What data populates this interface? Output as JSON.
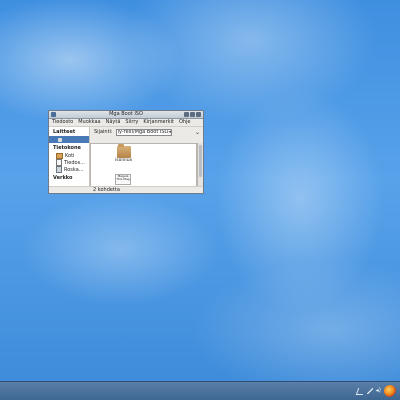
{
  "window": {
    "title": "Mga Boot ISO",
    "menu": [
      "Tiedosto",
      "Muokkaa",
      "Näytä",
      "Siirry",
      "Kirjanmerkit",
      "Ohje"
    ],
    "sidebar": {
      "sections": [
        {
          "heading": "Laitteet",
          "items": [
            {
              "label": "",
              "icon": "drive-icon",
              "selected": true
            }
          ]
        },
        {
          "heading": "Tietokone",
          "items": [
            {
              "label": "Koti",
              "icon": "home-folder-icon",
              "selected": false
            },
            {
              "label": "Tiedos...",
              "icon": "filesystem-icon",
              "selected": false
            },
            {
              "label": "Roska...",
              "icon": "trash-icon",
              "selected": false
            }
          ]
        },
        {
          "heading": "Verkko",
          "items": []
        }
      ]
    },
    "location": {
      "label": "Sijainti:",
      "value": "ly-rexi/Mga Boot ISO"
    },
    "files": [
      {
        "name": "isolinux",
        "type": "folder",
        "icon": "folder-icon"
      },
      {
        "name": "",
        "type": "document",
        "icon": "document-thumbnail-icon",
        "thumb_text": "Magela This Mag"
      }
    ],
    "status": "2 kohdetta"
  },
  "taskbar": {
    "tray_icons": [
      "network-icon",
      "volume-icon",
      "speaker-icon",
      "browser-icon"
    ]
  }
}
